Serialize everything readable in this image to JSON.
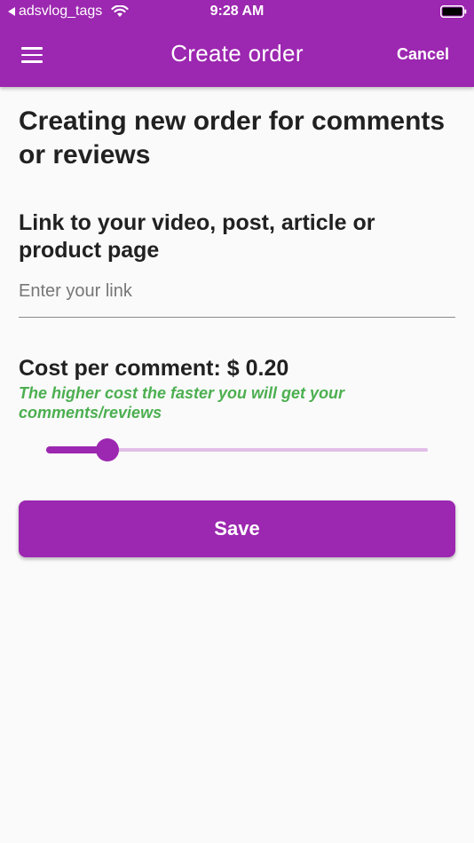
{
  "status_bar": {
    "back_app": "adsvlog_tags",
    "time": "9:28 AM",
    "battery_icon": "battery-full-icon",
    "wifi_icon": "wifi-icon"
  },
  "appbar": {
    "title": "Create order",
    "cancel_label": "Cancel",
    "menu_icon": "hamburger-menu-icon",
    "color": "#9c27b0"
  },
  "form": {
    "heading": "Creating new order for comments or reviews",
    "link_label": "Link to your video, post, article or product page",
    "link_placeholder": "Enter your link",
    "link_value": "",
    "cost_label": "Cost per comment: $ 0.20",
    "hint": "The higher cost the faster you will get your comments/reviews",
    "hint_color": "#4caf50",
    "slider_fraction": 0.16,
    "save_label": "Save"
  }
}
